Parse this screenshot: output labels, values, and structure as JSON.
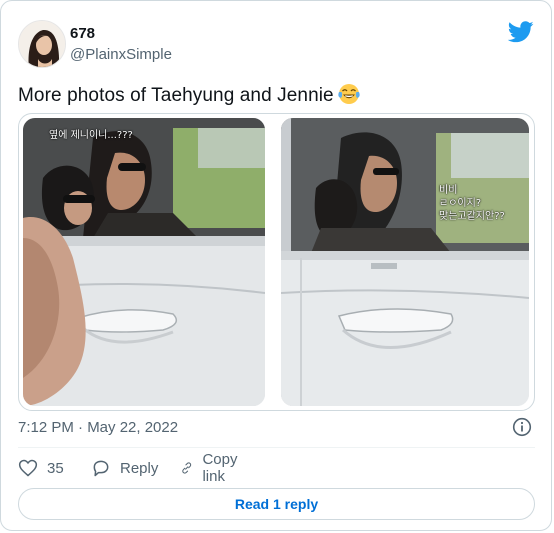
{
  "author": {
    "display_name": "678",
    "handle": "@PlainxSimple"
  },
  "tweet": {
    "text": "More photos of Taehyung and Jennie",
    "emoji": "face-with-tears-of-joy"
  },
  "media": {
    "left_caption": "옆에 제니이니...???",
    "right_caption_lines": [
      "비비",
      "ㄹㅇ이지?",
      "맞는고같지안??"
    ]
  },
  "timestamp": "7:12 PM · May 22, 2022",
  "actions": {
    "like_count": "35",
    "reply_label": "Reply",
    "copy_link_label": "Copy link"
  },
  "read_reply_label": "Read 1 reply",
  "colors": {
    "twitter_blue": "#1d9bf0",
    "link_blue": "#006fd6",
    "muted": "#536471",
    "border": "#cfd9de"
  }
}
